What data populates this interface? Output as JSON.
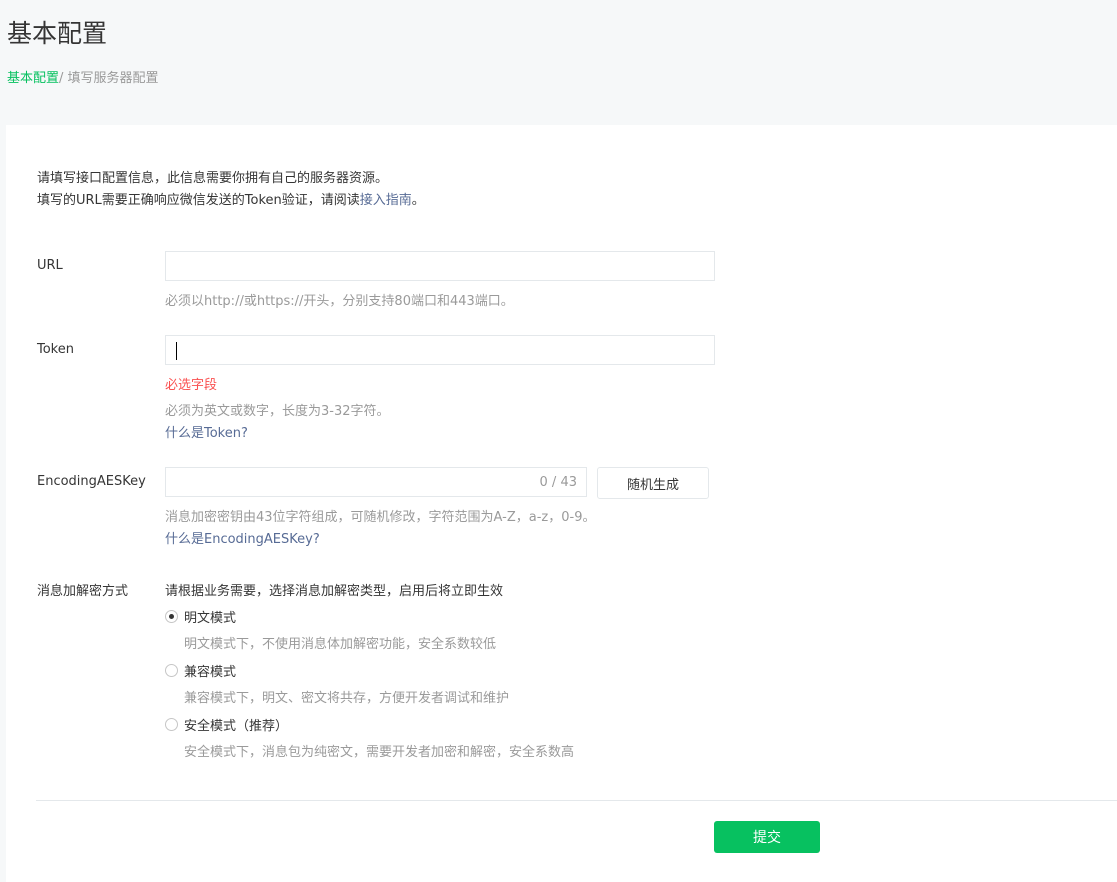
{
  "header": {
    "title": "基本配置",
    "breadcrumb": {
      "link": "基本配置",
      "separator": "/ ",
      "current": "填写服务器配置"
    }
  },
  "intro": {
    "line1": "请填写接口配置信息，此信息需要你拥有自己的服务器资源。",
    "line2_prefix": "填写的URL需要正确响应微信发送的Token验证，请阅读",
    "line2_link": "接入指南",
    "line2_suffix": "。"
  },
  "form": {
    "url": {
      "label": "URL",
      "value": "",
      "tip": "必须以http://或https://开头，分别支持80端口和443端口。"
    },
    "token": {
      "label": "Token",
      "value": "",
      "error": "必选字段",
      "tip": "必须为英文或数字，长度为3-32字符。",
      "help_link": "什么是Token?"
    },
    "aeskey": {
      "label": "EncodingAESKey",
      "value": "",
      "counter": "0 / 43",
      "random_button": "随机生成",
      "tip": "消息加密密钥由43位字符组成，可随机修改，字符范围为A-Z，a-z，0-9。",
      "help_link": "什么是EncodingAESKey?"
    },
    "encryption": {
      "label": "消息加解密方式",
      "description": "请根据业务需要，选择消息加解密类型，启用后将立即生效",
      "options": [
        {
          "label": "明文模式",
          "desc": "明文模式下，不使用消息体加解密功能，安全系数较低",
          "checked": true
        },
        {
          "label": "兼容模式",
          "desc": "兼容模式下，明文、密文将共存，方便开发者调试和维护",
          "checked": false
        },
        {
          "label": "安全模式（推荐）",
          "desc": "安全模式下，消息包为纯密文，需要开发者加密和解密，安全系数高",
          "checked": false
        }
      ]
    },
    "submit": "提交"
  },
  "colors": {
    "accent": "#07c160",
    "link": "#576b95",
    "error": "#fa5151",
    "muted": "#9a9a9a"
  }
}
